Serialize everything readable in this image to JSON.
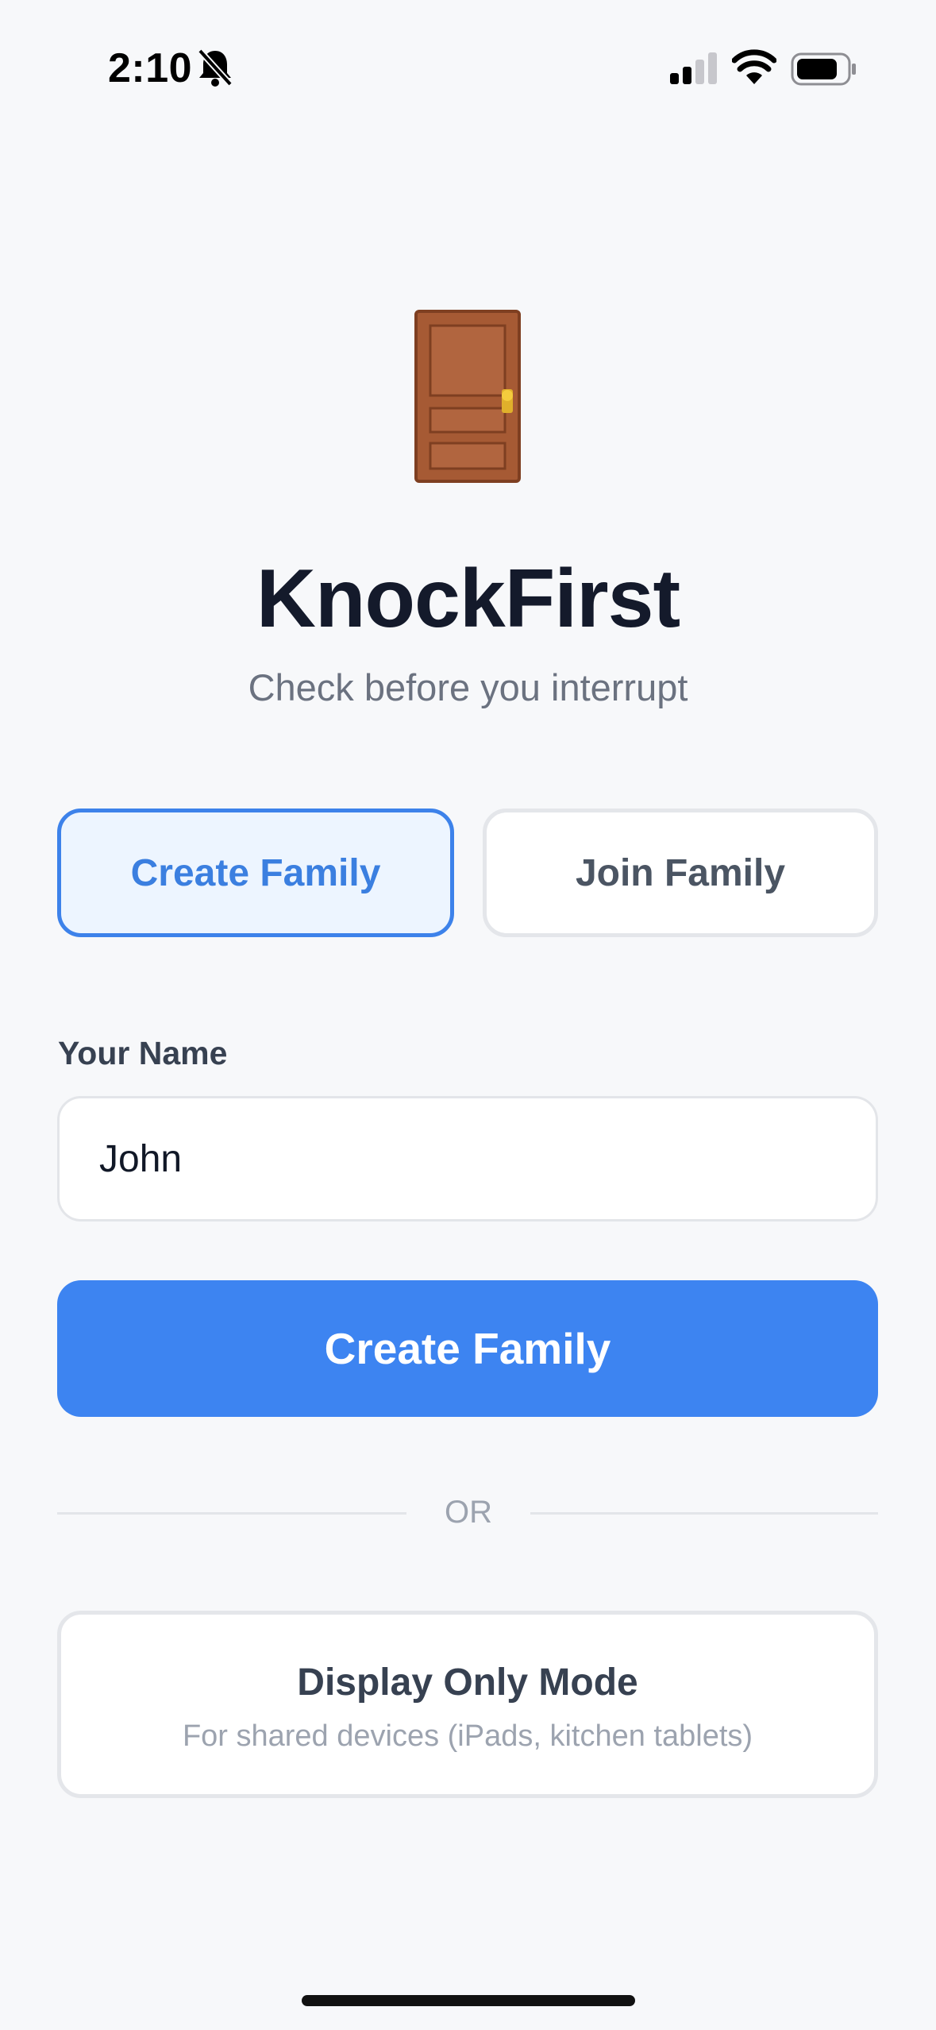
{
  "status_bar": {
    "time": "2:10",
    "icons": [
      "bell-slash-icon",
      "cellular-signal-icon",
      "wifi-icon",
      "battery-icon"
    ]
  },
  "app": {
    "logo_icon": "door-icon",
    "title": "KnockFirst",
    "subtitle": "Check before you interrupt"
  },
  "mode_tabs": {
    "selected": "Create Family",
    "items": [
      {
        "label": "Create Family"
      },
      {
        "label": "Join Family"
      }
    ]
  },
  "form": {
    "name_label": "Your Name",
    "name_value": "John",
    "submit_label": "Create Family"
  },
  "divider": {
    "text": "OR"
  },
  "display_mode": {
    "title": "Display Only Mode",
    "subtitle": "For shared devices (iPads, kitchen tablets)"
  },
  "colors": {
    "accent": "#3d84f1",
    "selected_tab_bg": "#edf5ff",
    "background": "#f7f8fa",
    "title": "#141a2b"
  }
}
